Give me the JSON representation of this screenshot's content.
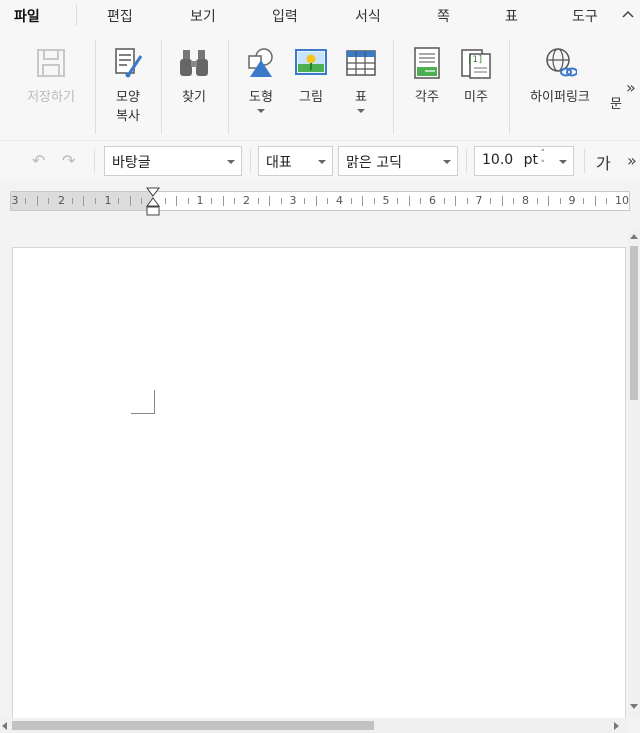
{
  "menu": {
    "tabs": [
      {
        "label": "파일",
        "active": true
      },
      {
        "label": "편집"
      },
      {
        "label": "보기"
      },
      {
        "label": "입력"
      },
      {
        "label": "서식"
      },
      {
        "label": "쪽"
      },
      {
        "label": "표"
      },
      {
        "label": "도구"
      }
    ],
    "collapse_icon": "chevron-up-icon"
  },
  "ribbon": {
    "save": {
      "label": "저장하기",
      "icon": "floppy-disk-icon",
      "disabled": true
    },
    "format_copy": {
      "label_line1": "모양",
      "label_line2": "복사",
      "icon": "format-painter-icon"
    },
    "find": {
      "label": "찾기",
      "icon": "binoculars-icon"
    },
    "shape": {
      "label": "도형",
      "icon": "shapes-icon",
      "has_dropdown": true
    },
    "picture": {
      "label": "그림",
      "icon": "picture-icon"
    },
    "table": {
      "label": "표",
      "icon": "table-icon",
      "has_dropdown": true
    },
    "footnote": {
      "label": "각주",
      "icon": "footnote-icon"
    },
    "endnote": {
      "label": "미주",
      "icon": "endnote-icon"
    },
    "hyperlink": {
      "label": "하이퍼링크",
      "icon": "hyperlink-globe-icon"
    },
    "more_partial": {
      "label": "문"
    },
    "more_icon": "double-chevron-right-icon"
  },
  "toolbar": {
    "undo_icon": "undo-icon",
    "redo_icon": "redo-icon",
    "font_face": "바탕글",
    "style": "대표",
    "font_name": "맑은 고딕",
    "font_size": "10.0",
    "font_size_unit": "pt",
    "char_format": "가",
    "more_icon": "double-chevron-right-icon"
  },
  "ruler": {
    "left_numbers": [
      "3",
      "2",
      "1"
    ],
    "right_numbers": [
      "1",
      "2",
      "3",
      "4",
      "5",
      "6",
      "7",
      "8",
      "9",
      "10"
    ]
  },
  "colors": {
    "accent_blue": "#3b79c9",
    "picture_green": "#4caf50",
    "footnote_green": "#2e7d32"
  }
}
